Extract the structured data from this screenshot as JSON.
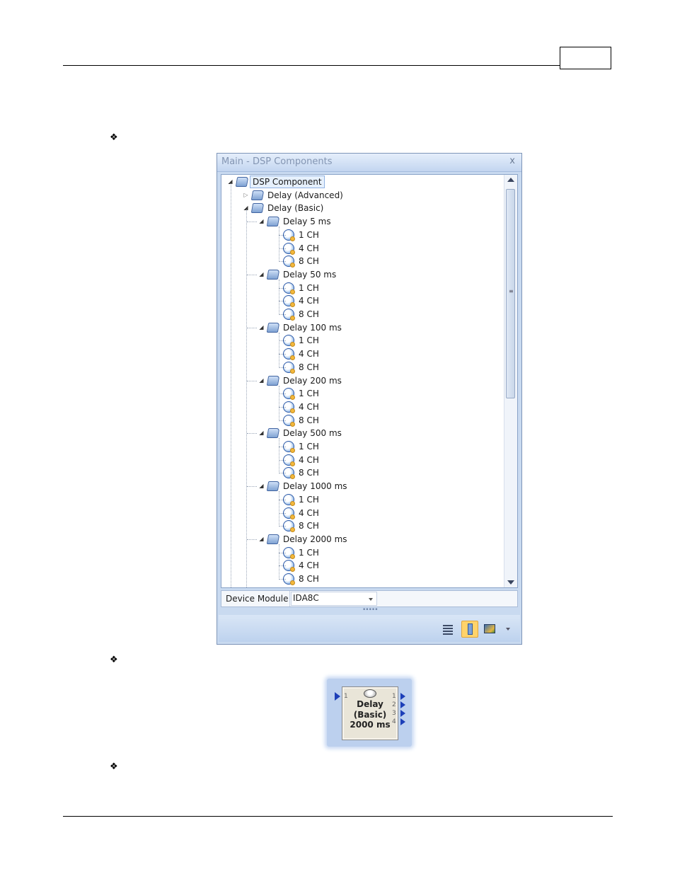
{
  "panel": {
    "title": "Main - DSP Components",
    "close_glyph": "x",
    "tree": {
      "root": "DSP Component",
      "advanced": "Delay (Advanced)",
      "basic": "Delay (Basic)",
      "groups": [
        {
          "label": "Delay 5 ms",
          "children": [
            "1 CH",
            "4 CH",
            "8 CH"
          ]
        },
        {
          "label": "Delay 50 ms",
          "children": [
            "1 CH",
            "4 CH",
            "8 CH"
          ]
        },
        {
          "label": "Delay 100 ms",
          "children": [
            "1 CH",
            "4 CH",
            "8 CH"
          ]
        },
        {
          "label": "Delay 200 ms",
          "children": [
            "1 CH",
            "4 CH",
            "8 CH"
          ]
        },
        {
          "label": "Delay 500 ms",
          "children": [
            "1 CH",
            "4 CH",
            "8 CH"
          ]
        },
        {
          "label": "Delay 1000 ms",
          "children": [
            "1 CH",
            "4 CH",
            "8 CH"
          ]
        },
        {
          "label": "Delay 2000 ms",
          "children": [
            "1 CH",
            "4 CH",
            "8 CH"
          ]
        }
      ]
    },
    "device_module": {
      "label": "Device Module",
      "value": "IDA8C"
    },
    "toolbar": {
      "icons": [
        "list-view-icon",
        "dsp-component-icon",
        "image-icon",
        "more-options-icon"
      ]
    }
  },
  "block": {
    "line1": "Delay",
    "line2": "(Basic)",
    "line3": "2000 ms",
    "input_pin": "1",
    "output_pins": [
      "1",
      "2",
      "3",
      "4"
    ],
    "pin_color": "#1d3fb8"
  },
  "bullets": [
    "❖",
    "❖",
    "❖"
  ]
}
